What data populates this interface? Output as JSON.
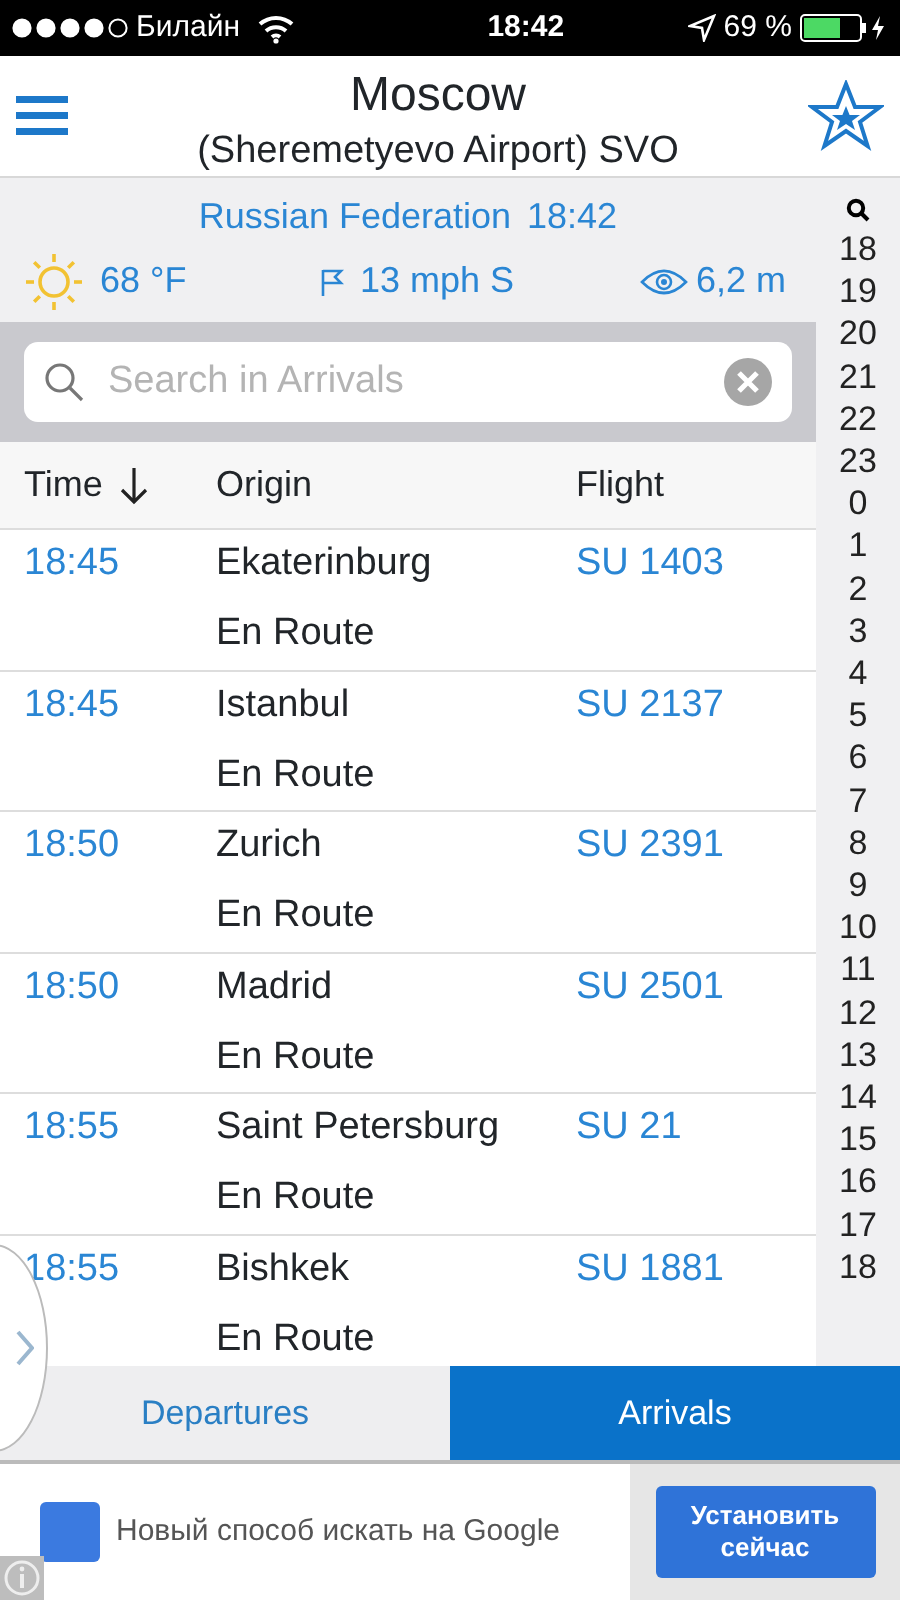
{
  "status_bar": {
    "carrier": "Билайн",
    "time": "18:42",
    "battery_text": "69 %",
    "battery": {
      "level": 0.69
    }
  },
  "header": {
    "title": "Moscow",
    "subtitle": "(Sheremetyevo Airport) SVO"
  },
  "info": {
    "country": "Russian Federation",
    "local_time": "18:42",
    "temperature": "68 °F",
    "wind": "13 mph S",
    "visibility": "6,2 m"
  },
  "search": {
    "placeholder": "Search in Arrivals"
  },
  "table": {
    "columns": [
      "Time",
      "Origin",
      "Flight"
    ],
    "rows": [
      {
        "time": "18:45",
        "origin": "Ekaterinburg",
        "status": "En Route",
        "flight": "SU 1403"
      },
      {
        "time": "18:45",
        "origin": "Istanbul",
        "status": "En Route",
        "flight": "SU 2137"
      },
      {
        "time": "18:50",
        "origin": "Zurich",
        "status": "En Route",
        "flight": "SU 2391"
      },
      {
        "time": "18:50",
        "origin": "Madrid",
        "status": "En Route",
        "flight": "SU 2501"
      },
      {
        "time": "18:55",
        "origin": "Saint Petersburg",
        "status": "En Route",
        "flight": "SU 21"
      },
      {
        "time": "18:55",
        "origin": "Bishkek",
        "status": "En Route",
        "flight": "SU 1881"
      }
    ]
  },
  "hour_index": [
    "18",
    "19",
    "20",
    "21",
    "22",
    "23",
    "0",
    "1",
    "2",
    "3",
    "4",
    "5",
    "6",
    "7",
    "8",
    "9",
    "10",
    "11",
    "12",
    "13",
    "14",
    "15",
    "16",
    "17",
    "18"
  ],
  "tabs": [
    {
      "label": "Departures",
      "selected": false
    },
    {
      "label": "Arrivals",
      "selected": true
    }
  ],
  "ad": {
    "text": "Новый способ искать на Google",
    "button": "Установить сейчас"
  }
}
